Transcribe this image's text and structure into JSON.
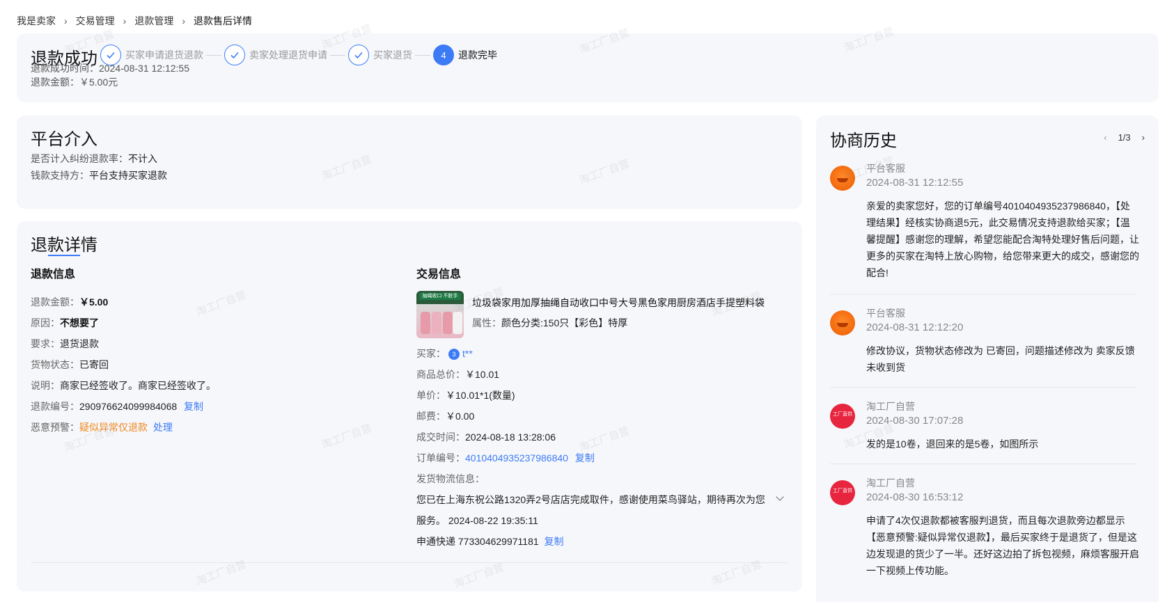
{
  "breadcrumb": [
    "我是卖家",
    "交易管理",
    "退款管理",
    "退款售后详情"
  ],
  "status": {
    "title": "退款成功",
    "steps": [
      {
        "label": "买家申请退货退款",
        "state": "done"
      },
      {
        "label": "卖家处理退货申请",
        "state": "done"
      },
      {
        "label": "买家退货",
        "state": "done"
      },
      {
        "label": "退款完毕",
        "state": "active",
        "number": "4"
      }
    ],
    "time_label": "退款成功时间：",
    "time_value": "2024-08-31 12:12:55",
    "amount_label": "退款金额：",
    "amount_value": "￥5.00元"
  },
  "platform": {
    "title": "平台介入",
    "rate_label": "是否计入纠纷退款率：",
    "rate_value": "不计入",
    "payer_label": "钱款支持方：",
    "payer_value": "平台支持买家退款"
  },
  "detail": {
    "title_part1": "退款",
    "title_part2": "详情",
    "refund": {
      "heading": "退款信息",
      "amount_label": "退款金额：",
      "amount_value": "￥5.00",
      "reason_label": "原因：",
      "reason_value": "不想要了",
      "request_label": "要求：",
      "request_value": "退货退款",
      "goods_label": "货物状态：",
      "goods_value": "已寄回",
      "note_label": "说明：",
      "note_value": "商家已经签收了。商家已经签收了。",
      "no_label": "退款编号：",
      "no_value": "290976624099984068",
      "copy": "复制",
      "warn_label": "恶意预警：",
      "warn_value": "疑似异常仅退款",
      "handle": "处理"
    },
    "trade": {
      "heading": "交易信息",
      "product_title": "垃圾袋家用加厚抽绳自动收口中号大号黑色家用厨房酒店手提塑料袋",
      "attr_label": "属性：",
      "attr_value": "颜色分类:150只【彩色】特厚",
      "thumb_banner": "抽绳收口 不脏手",
      "buyer_label": "买家：",
      "buyer_avatar": "3",
      "buyer_value": "t**",
      "total_label": "商品总价：",
      "total_value": "￥10.01",
      "unit_label": "单价：",
      "unit_value": "￥10.01*1(数量)",
      "postage_label": "邮费：",
      "postage_value": "￥0.00",
      "deal_label": "成交时间：",
      "deal_value": "2024-08-18 13:28:06",
      "order_label": "订单编号：",
      "order_value": "4010404935237986840",
      "copy": "复制",
      "logistics_label": "发货物流信息：",
      "logistics_line1": "您已在上海东祝公路1320弄2号店店完成取件，感谢使用菜鸟驿站，期待再次为您",
      "logistics_line2": "服务。 2024-08-22 19:35:11",
      "express": "申通快递 773304629971181",
      "copy2": "复制"
    }
  },
  "history": {
    "title": "协商历史",
    "page": "1/3",
    "prev": "‹",
    "next": "›",
    "messages": [
      {
        "name": "平台客服",
        "time": "2024-08-31 12:12:55",
        "lines": [
          "亲爱的卖家您好，您的订单编号4010404935237986840，【处",
          "理结果】经核实协商退5元，此交易情况支持退款给买家；【温",
          "馨提醒】感谢您的理解，希望您能配合淘特处理好售后问题，让",
          "更多的买家在淘特上放心购物，给您带来更大的成交，感谢您的",
          "配合!"
        ]
      },
      {
        "name": "平台客服",
        "time": "2024-08-31 12:12:20",
        "lines": [
          "修改协议，货物状态修改为 已寄回，问题描述修改为 卖家反馈",
          "未收到货"
        ]
      },
      {
        "name": "淘工厂自营",
        "time": "2024-08-30 17:07:28",
        "lines": [
          "发的是10卷，退回来的是5卷，如图所示"
        ]
      },
      {
        "name": "淘工厂自营",
        "time": "2024-08-30 16:53:12",
        "lines": [
          "申请了4次仅退款都被客服判退货，而且每次退款旁边都显示",
          "【恶意预警:疑似异常仅退款】，最后买家终于是退货了，但是这",
          "边发现退的货少了一半。还好这边拍了拆包视频，麻烦客服开启",
          "一下视频上传功能。"
        ]
      }
    ],
    "store_avatar_text": "工厂直供"
  },
  "watermark": "淘工厂自营"
}
